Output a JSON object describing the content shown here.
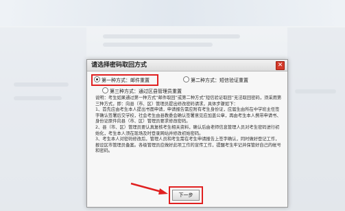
{
  "dialog": {
    "title": "请选择密码取回方式",
    "close_glyph": "✕",
    "options": [
      {
        "label": "第一种方式：邮件重置",
        "checked": true
      },
      {
        "label": "第二种方式：短信验证重置",
        "checked": false
      },
      {
        "label": "第三种方式：通过区县管理员重置",
        "checked": false
      }
    ],
    "description": [
      "说明：考生如果通过第一种方式“邮件取回”或第二种方式“短信验证取回”无法取回密码，须采用第三种方式，即：向县（市、区）管理员提出修改密码请求，具体步骤如下：",
      "1、首先应由考生本人提出书面申请，申请报告需应附有考生身份证，应届生由所在中学班主任签字确认签署后交学校，社会考生由县教委会确认签署意见应加盖公章，再由考生本人携带申请书、身份证原件向县（市、区）管理员要求修改密码。",
      "2、县（市、区）管理员要认真复核考生相关资料，确认后由老师信息管理人员对考生密码进行初始化，考生本人须在现场及时登录网站并修改初始密码。",
      "3、考生本人对密码修改后，管理人员和考生需在考生申请报告上签字确认，同时做好登记工作，报设区市管理员备案。各级管理员应做好此项工作的宣传工作，提醒考生牢记并保管好自己的帐号和密码。"
    ],
    "next_button": "下一步"
  }
}
